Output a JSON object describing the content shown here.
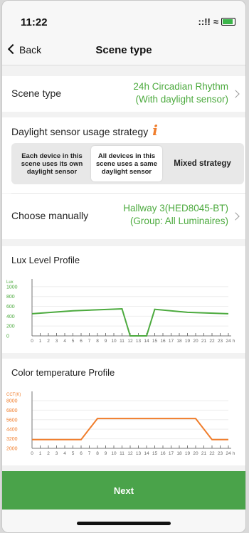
{
  "status_bar": {
    "time": "11:22",
    "signal": "::!!",
    "wifi": "≈"
  },
  "nav": {
    "back_label": "Back",
    "title": "Scene type"
  },
  "scene_type_row": {
    "label": "Scene type",
    "value_line1": "24h Circadian Rhythm",
    "value_line2": "(With daylight sensor)"
  },
  "strategy": {
    "title": "Daylight sensor usage strategy",
    "info_glyph": "i",
    "options": [
      {
        "line1": "Each device in this",
        "line2": "scene uses its own",
        "line3": "daylight sensor",
        "selected": false
      },
      {
        "line1": "All devices in this",
        "line2": "scene uses a same",
        "line3": "daylight sensor",
        "selected": true
      },
      {
        "line1": "Mixed strategy",
        "line2": "",
        "line3": "",
        "selected": false
      }
    ]
  },
  "choose_row": {
    "label": "Choose manually",
    "value_line1": "Hallway 3(HED8045-BT)",
    "value_line2": "(Group: All Luminaires)"
  },
  "chart_data": [
    {
      "type": "line",
      "title": "Lux Level Profile",
      "ylabel": "Lux",
      "xlabel": "h",
      "x": [
        0,
        1,
        2,
        3,
        4,
        5,
        6,
        7,
        8,
        9,
        10,
        11,
        12,
        13,
        14,
        15,
        16,
        17,
        18,
        19,
        20,
        21,
        22,
        23,
        24
      ],
      "y_ticks": [
        0,
        200,
        400,
        600,
        800,
        1000
      ],
      "ylim": [
        0,
        1100
      ],
      "color": "#4caa3e",
      "series": [
        {
          "points": [
            [
              0,
              450
            ],
            [
              5,
              510
            ],
            [
              11,
              550
            ],
            [
              12,
              0
            ],
            [
              14,
              0
            ],
            [
              15,
              540
            ],
            [
              19,
              480
            ],
            [
              24,
              450
            ]
          ]
        }
      ]
    },
    {
      "type": "line",
      "title": "Color temperature Profile",
      "ylabel": "CCT(K)",
      "xlabel": "h",
      "x": [
        0,
        1,
        2,
        3,
        4,
        5,
        6,
        7,
        8,
        9,
        10,
        11,
        12,
        13,
        14,
        15,
        16,
        17,
        18,
        19,
        20,
        21,
        22,
        23,
        24
      ],
      "y_ticks": [
        2000,
        3200,
        4400,
        5600,
        6800,
        8000
      ],
      "ylim": [
        2000,
        8800
      ],
      "color": "#f07d2b",
      "series": [
        {
          "points": [
            [
              0,
              3100
            ],
            [
              6,
              3100
            ],
            [
              8,
              5750
            ],
            [
              20,
              5750
            ],
            [
              22,
              3100
            ],
            [
              24,
              3100
            ]
          ]
        }
      ]
    }
  ],
  "footer": {
    "next_label": "Next"
  }
}
